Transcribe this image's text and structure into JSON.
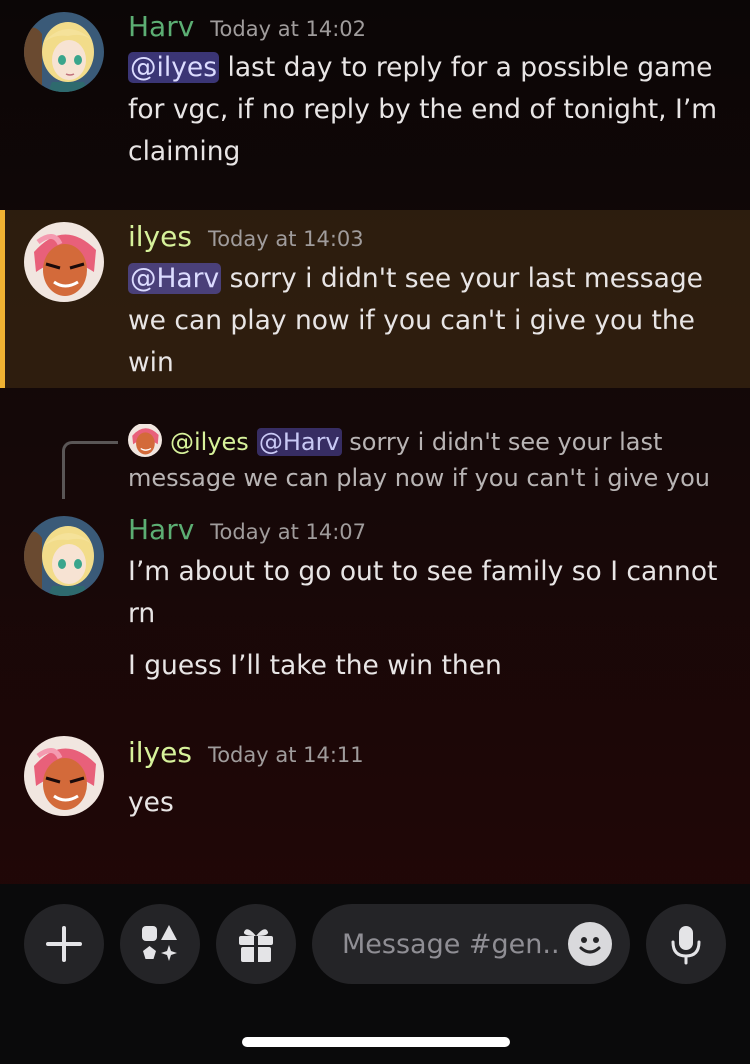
{
  "messages": [
    {
      "username": "Harv",
      "timestamp": "Today at 14:02",
      "mention": "@ilyes",
      "text": " last day to reply for a possible game for vgc, if no reply by the end of tonight, I’m claiming"
    },
    {
      "username": "ilyes",
      "timestamp": "Today at 14:03",
      "mention": "@Harv",
      "text": " sorry i didn't see your last message we can play now if you can't i give you the win",
      "highlighted": true
    },
    {
      "username": "Harv",
      "timestamp": "Today at 14:07",
      "reply": {
        "username": "@ilyes",
        "mention": "@Harv",
        "text": " sorry i didn't see your last message we can play now if you can't i give you t..."
      },
      "text": "I’m about to go out to see family so I cannot rn",
      "text2": "I guess I’ll take the win then"
    },
    {
      "username": "ilyes",
      "timestamp": "Today at 14:11",
      "text": "yes"
    }
  ],
  "composer": {
    "placeholder": "Message #gen..."
  },
  "icons": {
    "add": "plus-icon",
    "apps": "apps-icon",
    "gift": "gift-icon",
    "emoji": "emoji-icon",
    "voice": "microphone-icon"
  },
  "colors": {
    "harv_name": "#5cae73",
    "ilyes_name": "#d7f29b",
    "mention_bg": "#625cd2",
    "highlight_border": "#f0b232"
  }
}
